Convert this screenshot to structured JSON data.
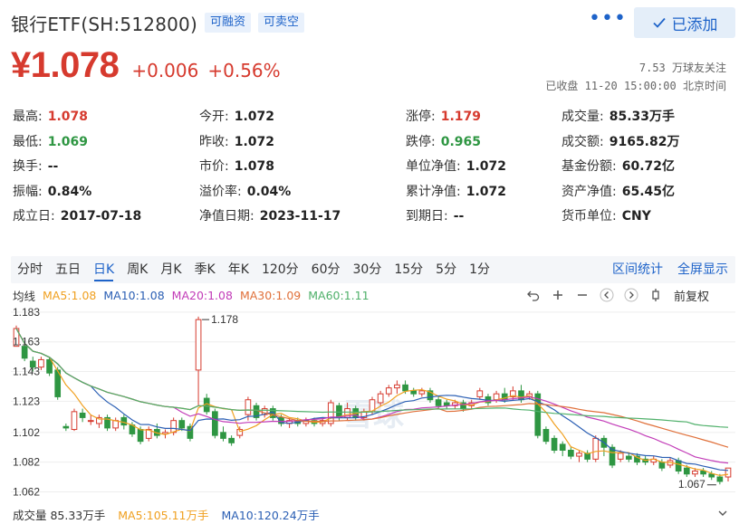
{
  "header": {
    "title": "银行ETF(SH:512800)",
    "tags": [
      "可融资",
      "可卖空"
    ],
    "more_label": "•••",
    "added_label": "已添加"
  },
  "price": {
    "current": "¥1.078",
    "change": "+0.006",
    "change_pct": "+0.56%",
    "followers": "7.53 万球友关注",
    "status": "已收盘 11-20 15:00:00 北京时间"
  },
  "quote": {
    "rows": [
      [
        {
          "label": "最高:",
          "value": "1.078",
          "color": "red"
        },
        {
          "label": "今开:",
          "value": "1.072",
          "color": "dark"
        },
        {
          "label": "涨停:",
          "value": "1.179",
          "color": "red"
        },
        {
          "label": "成交量:",
          "value": "85.33万手",
          "color": "dark"
        }
      ],
      [
        {
          "label": "最低:",
          "value": "1.069",
          "color": "green"
        },
        {
          "label": "昨收:",
          "value": "1.072",
          "color": "dark"
        },
        {
          "label": "跌停:",
          "value": "0.965",
          "color": "green"
        },
        {
          "label": "成交额:",
          "value": "9165.82万",
          "color": "dark"
        }
      ],
      [
        {
          "label": "换手:",
          "value": "--",
          "color": "dark"
        },
        {
          "label": "市价:",
          "value": "1.078",
          "color": "dark"
        },
        {
          "label": "单位净值:",
          "value": "1.072",
          "color": "dark"
        },
        {
          "label": "基金份额:",
          "value": "60.72亿",
          "color": "dark"
        }
      ],
      [
        {
          "label": "振幅:",
          "value": "0.84%",
          "color": "dark"
        },
        {
          "label": "溢价率:",
          "value": "0.04%",
          "color": "dark"
        },
        {
          "label": "累计净值:",
          "value": "1.072",
          "color": "dark"
        },
        {
          "label": "资产净值:",
          "value": "65.45亿",
          "color": "dark"
        }
      ],
      [
        {
          "label": "成立日:",
          "value": "2017-07-18",
          "color": "dark"
        },
        {
          "label": "净值日期:",
          "value": "2023-11-17",
          "color": "dark"
        },
        {
          "label": "到期日:",
          "value": "--",
          "color": "dark"
        },
        {
          "label": "货币单位:",
          "value": "CNY",
          "color": "dark"
        }
      ]
    ]
  },
  "tabs": {
    "items": [
      "分时",
      "五日",
      "日K",
      "周K",
      "月K",
      "季K",
      "年K",
      "120分",
      "60分",
      "30分",
      "15分",
      "5分",
      "1分"
    ],
    "active": "日K",
    "right": [
      "区间统计",
      "全屏显示"
    ]
  },
  "ma_legend": {
    "label": "均线",
    "items": [
      {
        "text": "MA5:1.08",
        "color": "#f0a020"
      },
      {
        "text": "MA10:1.08",
        "color": "#2b5fb4"
      },
      {
        "text": "MA20:1.08",
        "color": "#c23cb8"
      },
      {
        "text": "MA30:1.09",
        "color": "#e0703a"
      },
      {
        "text": "MA60:1.11",
        "color": "#4fb06a"
      }
    ],
    "controls": [
      "undo-icon",
      "zoom-in-icon",
      "zoom-out-icon",
      "chevron-left-icon",
      "chevron-right-icon",
      "candle-icon"
    ],
    "adjust_label": "前复权"
  },
  "volume_legend": {
    "items": [
      {
        "text": "成交量 85.33万手",
        "color": "#333333"
      },
      {
        "text": "MA5:105.11万手",
        "color": "#f0a020"
      },
      {
        "text": "MA10:120.24万手",
        "color": "#2b5fb4"
      }
    ]
  },
  "chart_data": {
    "type": "candlestick",
    "y_ticks": [
      "1.183",
      "1.163",
      "1.143",
      "1.123",
      "1.102",
      "1.082",
      "1.062"
    ],
    "ylim": [
      1.058,
      1.186
    ],
    "annotations": {
      "max_label": "1.178",
      "min_label": "1.067"
    },
    "watermark": "雪球",
    "colors": {
      "up": "#d63a2e",
      "down": "#2e9642",
      "grid": "#eeeeee"
    },
    "candles": [
      [
        1.16,
        1.172,
        1.162,
        1.174
      ],
      [
        1.16,
        1.152,
        1.15,
        1.162
      ],
      [
        1.15,
        1.146,
        1.143,
        1.153
      ],
      [
        1.146,
        1.151,
        1.144,
        1.153
      ],
      [
        1.151,
        1.142,
        1.14,
        1.153
      ],
      [
        1.144,
        1.126,
        1.124,
        1.146
      ],
      [
        1.106,
        1.105,
        1.103,
        1.108
      ],
      [
        1.104,
        1.116,
        1.103,
        1.118
      ],
      [
        1.115,
        1.112,
        1.109,
        1.118
      ],
      [
        1.11,
        1.11,
        1.107,
        1.114
      ],
      [
        1.108,
        1.112,
        1.105,
        1.114
      ],
      [
        1.112,
        1.105,
        1.103,
        1.114
      ],
      [
        1.105,
        1.11,
        1.103,
        1.112
      ],
      [
        1.112,
        1.107,
        1.104,
        1.114
      ],
      [
        1.107,
        1.101,
        1.099,
        1.109
      ],
      [
        1.104,
        1.096,
        1.094,
        1.106
      ],
      [
        1.098,
        1.104,
        1.096,
        1.106
      ],
      [
        1.104,
        1.1,
        1.098,
        1.108
      ],
      [
        1.101,
        1.102,
        1.098,
        1.104
      ],
      [
        1.102,
        1.11,
        1.1,
        1.112
      ],
      [
        1.11,
        1.105,
        1.103,
        1.112
      ],
      [
        1.106,
        1.098,
        1.096,
        1.108
      ],
      [
        1.144,
        1.178,
        1.12,
        1.18
      ],
      [
        1.125,
        1.116,
        1.114,
        1.128
      ],
      [
        1.116,
        1.1,
        1.098,
        1.118
      ],
      [
        1.102,
        1.098,
        1.096,
        1.106
      ],
      [
        1.098,
        1.095,
        1.093,
        1.1
      ],
      [
        1.1,
        1.104,
        1.098,
        1.106
      ],
      [
        1.114,
        1.124,
        1.11,
        1.126
      ],
      [
        1.12,
        1.112,
        1.11,
        1.122
      ],
      [
        1.114,
        1.118,
        1.112,
        1.12
      ],
      [
        1.118,
        1.112,
        1.11,
        1.12
      ],
      [
        1.112,
        1.108,
        1.106,
        1.114
      ],
      [
        1.108,
        1.11,
        1.105,
        1.112
      ],
      [
        1.11,
        1.108,
        1.106,
        1.112
      ],
      [
        1.108,
        1.11,
        1.106,
        1.112
      ],
      [
        1.11,
        1.108,
        1.106,
        1.112
      ],
      [
        1.108,
        1.11,
        1.106,
        1.112
      ],
      [
        1.108,
        1.122,
        1.106,
        1.124
      ],
      [
        1.12,
        1.112,
        1.11,
        1.122
      ],
      [
        1.112,
        1.118,
        1.11,
        1.122
      ],
      [
        1.118,
        1.112,
        1.11,
        1.12
      ],
      [
        1.112,
        1.116,
        1.11,
        1.118
      ],
      [
        1.116,
        1.124,
        1.114,
        1.126
      ],
      [
        1.122,
        1.128,
        1.12,
        1.13
      ],
      [
        1.128,
        1.132,
        1.126,
        1.134
      ],
      [
        1.132,
        1.134,
        1.128,
        1.137
      ],
      [
        1.134,
        1.13,
        1.128,
        1.137
      ],
      [
        1.13,
        1.128,
        1.126,
        1.132
      ],
      [
        1.128,
        1.13,
        1.126,
        1.132
      ],
      [
        1.13,
        1.124,
        1.122,
        1.132
      ],
      [
        1.124,
        1.12,
        1.118,
        1.126
      ],
      [
        1.122,
        1.12,
        1.118,
        1.124
      ],
      [
        1.12,
        1.122,
        1.118,
        1.124
      ],
      [
        1.122,
        1.118,
        1.116,
        1.124
      ],
      [
        1.12,
        1.122,
        1.118,
        1.124
      ],
      [
        1.126,
        1.13,
        1.124,
        1.132
      ],
      [
        1.126,
        1.122,
        1.12,
        1.128
      ],
      [
        1.124,
        1.128,
        1.122,
        1.13
      ],
      [
        1.128,
        1.124,
        1.122,
        1.132
      ],
      [
        1.126,
        1.13,
        1.124,
        1.133
      ],
      [
        1.13,
        1.124,
        1.122,
        1.134
      ],
      [
        1.126,
        1.128,
        1.124,
        1.13
      ],
      [
        1.128,
        1.1,
        1.098,
        1.13
      ],
      [
        1.104,
        1.096,
        1.094,
        1.106
      ],
      [
        1.098,
        1.09,
        1.088,
        1.1
      ],
      [
        1.094,
        1.09,
        1.086,
        1.096
      ],
      [
        1.09,
        1.086,
        1.084,
        1.092
      ],
      [
        1.086,
        1.088,
        1.082,
        1.09
      ],
      [
        1.088,
        1.084,
        1.082,
        1.09
      ],
      [
        1.084,
        1.098,
        1.082,
        1.1
      ],
      [
        1.098,
        1.092,
        1.086,
        1.1
      ],
      [
        1.092,
        1.08,
        1.078,
        1.094
      ],
      [
        1.084,
        1.088,
        1.082,
        1.09
      ],
      [
        1.086,
        1.084,
        1.082,
        1.088
      ],
      [
        1.086,
        1.082,
        1.08,
        1.088
      ],
      [
        1.084,
        1.082,
        1.08,
        1.086
      ],
      [
        1.082,
        1.084,
        1.08,
        1.086
      ],
      [
        1.082,
        1.078,
        1.076,
        1.084
      ],
      [
        1.08,
        1.083,
        1.078,
        1.085
      ],
      [
        1.083,
        1.076,
        1.074,
        1.085
      ],
      [
        1.078,
        1.074,
        1.072,
        1.08
      ],
      [
        1.074,
        1.076,
        1.072,
        1.078
      ],
      [
        1.076,
        1.074,
        1.072,
        1.078
      ],
      [
        1.074,
        1.072,
        1.07,
        1.076
      ],
      [
        1.072,
        1.069,
        1.067,
        1.074
      ],
      [
        1.072,
        1.078,
        1.069,
        1.078
      ]
    ]
  }
}
